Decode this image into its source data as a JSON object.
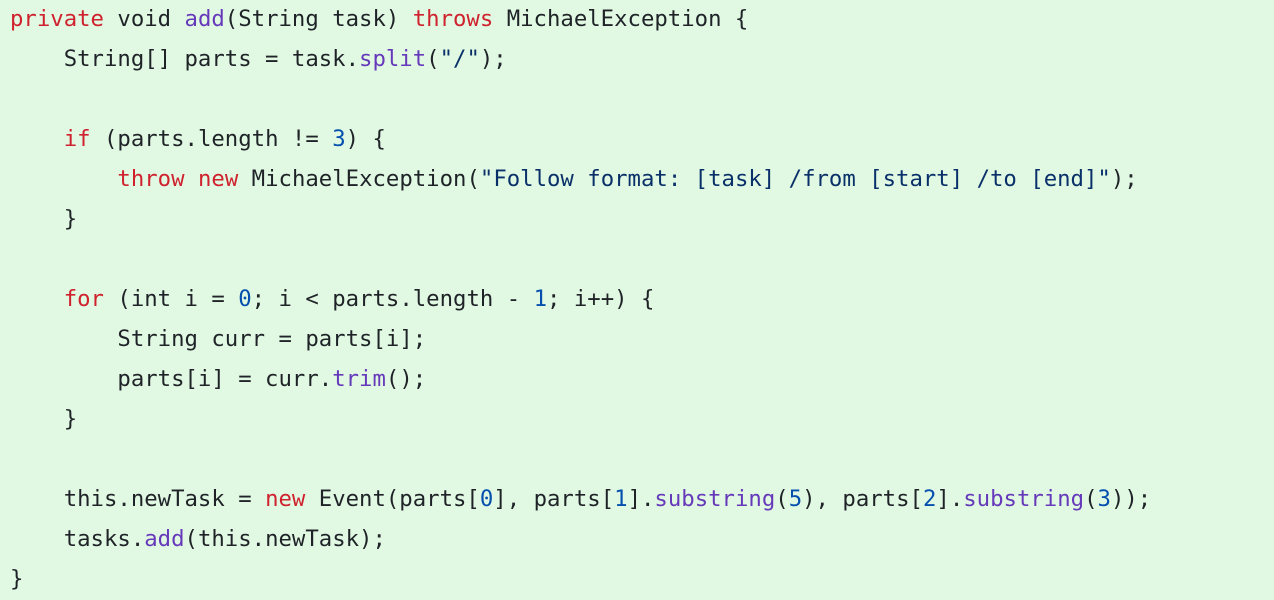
{
  "colors": {
    "background": "#e1f9e3",
    "plain": "#1f2328",
    "keyword": "#cf222e",
    "function": "#6639ba",
    "string": "#0a3069",
    "number": "#0550ae"
  },
  "code": {
    "language": "java",
    "lines": [
      [
        {
          "t": "kw",
          "v": "private"
        },
        {
          "t": "plain",
          "v": " void "
        },
        {
          "t": "fn",
          "v": "add"
        },
        {
          "t": "plain",
          "v": "(String task) "
        },
        {
          "t": "kw",
          "v": "throws"
        },
        {
          "t": "plain",
          "v": " MichaelException {"
        }
      ],
      [
        {
          "t": "plain",
          "v": "    String[] parts = task."
        },
        {
          "t": "fn",
          "v": "split"
        },
        {
          "t": "plain",
          "v": "("
        },
        {
          "t": "str",
          "v": "\"/\""
        },
        {
          "t": "plain",
          "v": ");"
        }
      ],
      [],
      [
        {
          "t": "plain",
          "v": "    "
        },
        {
          "t": "kw",
          "v": "if"
        },
        {
          "t": "plain",
          "v": " (parts.length != "
        },
        {
          "t": "num",
          "v": "3"
        },
        {
          "t": "plain",
          "v": ") {"
        }
      ],
      [
        {
          "t": "plain",
          "v": "        "
        },
        {
          "t": "kw",
          "v": "throw"
        },
        {
          "t": "plain",
          "v": " "
        },
        {
          "t": "kw",
          "v": "new"
        },
        {
          "t": "plain",
          "v": " MichaelException("
        },
        {
          "t": "str",
          "v": "\"Follow format: [task] /from [start] /to [end]\""
        },
        {
          "t": "plain",
          "v": ");"
        }
      ],
      [
        {
          "t": "plain",
          "v": "    }"
        }
      ],
      [],
      [
        {
          "t": "plain",
          "v": "    "
        },
        {
          "t": "kw",
          "v": "for"
        },
        {
          "t": "plain",
          "v": " (int i = "
        },
        {
          "t": "num",
          "v": "0"
        },
        {
          "t": "plain",
          "v": "; i < parts.length - "
        },
        {
          "t": "num",
          "v": "1"
        },
        {
          "t": "plain",
          "v": "; i++) {"
        }
      ],
      [
        {
          "t": "plain",
          "v": "        String curr = parts[i];"
        }
      ],
      [
        {
          "t": "plain",
          "v": "        parts[i] = curr."
        },
        {
          "t": "fn",
          "v": "trim"
        },
        {
          "t": "plain",
          "v": "();"
        }
      ],
      [
        {
          "t": "plain",
          "v": "    }"
        }
      ],
      [],
      [
        {
          "t": "plain",
          "v": "    this.newTask = "
        },
        {
          "t": "kw",
          "v": "new"
        },
        {
          "t": "plain",
          "v": " Event(parts["
        },
        {
          "t": "num",
          "v": "0"
        },
        {
          "t": "plain",
          "v": "], parts["
        },
        {
          "t": "num",
          "v": "1"
        },
        {
          "t": "plain",
          "v": "]."
        },
        {
          "t": "fn",
          "v": "substring"
        },
        {
          "t": "plain",
          "v": "("
        },
        {
          "t": "num",
          "v": "5"
        },
        {
          "t": "plain",
          "v": "), parts["
        },
        {
          "t": "num",
          "v": "2"
        },
        {
          "t": "plain",
          "v": "]."
        },
        {
          "t": "fn",
          "v": "substring"
        },
        {
          "t": "plain",
          "v": "("
        },
        {
          "t": "num",
          "v": "3"
        },
        {
          "t": "plain",
          "v": "));"
        }
      ],
      [
        {
          "t": "plain",
          "v": "    tasks."
        },
        {
          "t": "fn",
          "v": "add"
        },
        {
          "t": "plain",
          "v": "(this.newTask);"
        }
      ],
      [
        {
          "t": "plain",
          "v": "}"
        }
      ]
    ]
  }
}
